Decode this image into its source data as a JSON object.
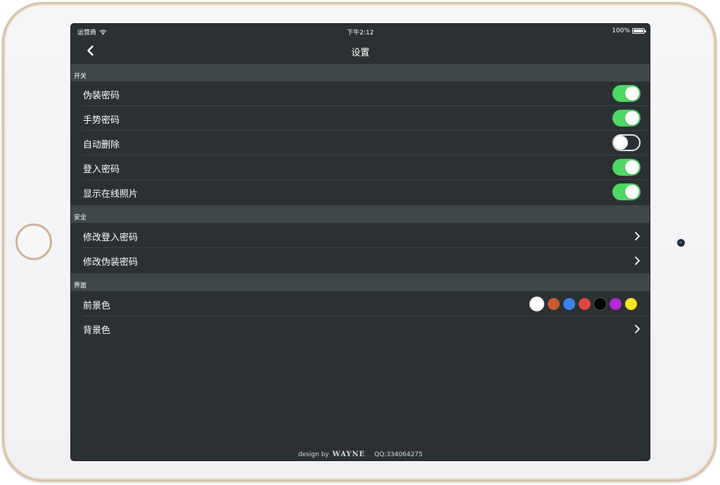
{
  "status_bar": {
    "carrier": "运营商",
    "time": "下午2:12",
    "battery": "100%"
  },
  "nav": {
    "title": "设置"
  },
  "sections": {
    "switches": {
      "header": "开关",
      "rows": [
        {
          "label": "伪装密码",
          "on": true
        },
        {
          "label": "手势密码",
          "on": true
        },
        {
          "label": "自动删除",
          "on": false
        },
        {
          "label": "登入密码",
          "on": true
        },
        {
          "label": "显示在线照片",
          "on": true
        }
      ]
    },
    "security": {
      "header": "安全",
      "rows": [
        {
          "label": "修改登入密码"
        },
        {
          "label": "修改伪装密码"
        }
      ]
    },
    "interface": {
      "header": "界面",
      "rows": [
        {
          "label": "前景色"
        },
        {
          "label": "背景色"
        }
      ],
      "foreground_colors": [
        "#ffffff",
        "#c85a2e",
        "#3b82e6",
        "#e04444",
        "#000000",
        "#b52ad6",
        "#f2e626"
      ]
    }
  },
  "footer": {
    "prefix": "design by",
    "brand": "WAYNE",
    "qq": "QQ:334064275"
  },
  "colors": {
    "accent_on": "#4cd964",
    "background": "#2b3032",
    "section_header": "#40474a"
  }
}
